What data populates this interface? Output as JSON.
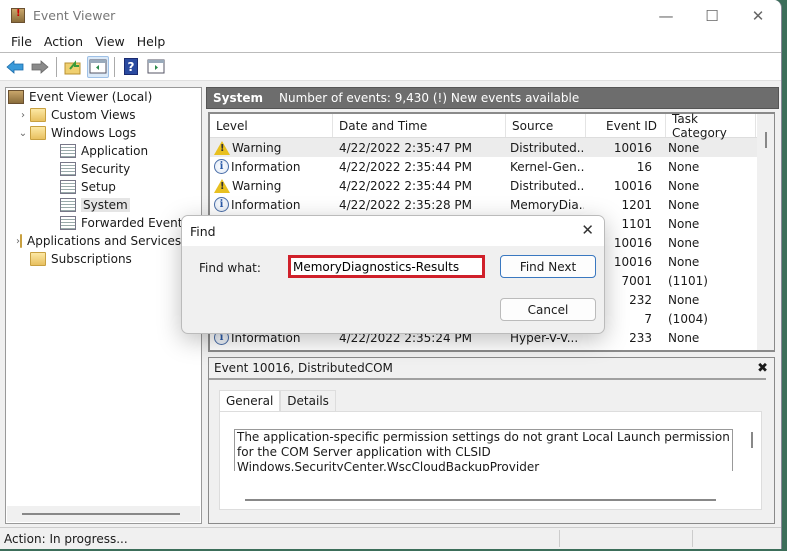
{
  "window": {
    "title": "Event Viewer",
    "minimize": "—",
    "maximize": "☐",
    "close": "✕"
  },
  "menu": [
    "File",
    "Action",
    "View",
    "Help"
  ],
  "toolbar": {
    "icons": [
      "back-arrow-icon",
      "forward-arrow-icon",
      "up-folder-icon",
      "show-hide-console-tree-icon",
      "help-icon",
      "show-hide-action-pane-icon"
    ]
  },
  "tree": [
    {
      "label": "Event Viewer (Local)",
      "indent": 0,
      "chevron": "",
      "icon": "root"
    },
    {
      "label": "Custom Views",
      "indent": 1,
      "chevron": "›",
      "icon": "folder"
    },
    {
      "label": "Windows Logs",
      "indent": 1,
      "chevron": "⌄",
      "icon": "folder"
    },
    {
      "label": "Application",
      "indent": 2,
      "chevron": "",
      "icon": "log"
    },
    {
      "label": "Security",
      "indent": 2,
      "chevron": "",
      "icon": "log"
    },
    {
      "label": "Setup",
      "indent": 2,
      "chevron": "",
      "icon": "log"
    },
    {
      "label": "System",
      "indent": 2,
      "chevron": "",
      "icon": "log",
      "selected": true
    },
    {
      "label": "Forwarded Events",
      "indent": 2,
      "chevron": "",
      "icon": "log"
    },
    {
      "label": "Applications and Services Logs",
      "indent": 1,
      "chevron": "›",
      "icon": "folder"
    },
    {
      "label": "Subscriptions",
      "indent": 1,
      "chevron": "",
      "icon": "folder"
    }
  ],
  "pane": {
    "name": "System",
    "info": "Number of events: 9,430 (!) New events available"
  },
  "grid": {
    "columns": [
      "Level",
      "Date and Time",
      "Source",
      "Event ID",
      "Task Category"
    ],
    "rows": [
      {
        "level": "Warning",
        "date": "4/22/2022 2:35:47 PM",
        "source": "Distributed...",
        "id": "10016",
        "task": "None",
        "selected": true
      },
      {
        "level": "Information",
        "date": "4/22/2022 2:35:44 PM",
        "source": "Kernel-Gen...",
        "id": "16",
        "task": "None"
      },
      {
        "level": "Warning",
        "date": "4/22/2022 2:35:44 PM",
        "source": "Distributed...",
        "id": "10016",
        "task": "None"
      },
      {
        "level": "Information",
        "date": "4/22/2022 2:35:28 PM",
        "source": "MemoryDia...",
        "id": "1201",
        "task": "None"
      },
      {
        "level": "",
        "date": "",
        "source": "",
        "id": "1101",
        "task": "None"
      },
      {
        "level": "",
        "date": "",
        "source": "",
        "id": "10016",
        "task": "None"
      },
      {
        "level": "",
        "date": "",
        "source": "",
        "id": "10016",
        "task": "None"
      },
      {
        "level": "",
        "date": "",
        "source": "",
        "id": "7001",
        "task": "(1101)"
      },
      {
        "level": "",
        "date": "",
        "source": "",
        "id": "232",
        "task": "None"
      },
      {
        "level": "",
        "date": "",
        "source": "",
        "id": "7",
        "task": "(1004)"
      },
      {
        "level": "Information",
        "date": "4/22/2022 2:35:24 PM",
        "source": "Hyper-V-V...",
        "id": "233",
        "task": "None"
      }
    ]
  },
  "detail": {
    "title": "Event 10016, DistributedCOM",
    "close": "✖",
    "tabs": [
      "General",
      "Details"
    ],
    "description": "The application-specific permission settings do not grant Local Launch permission for the COM Server application with CLSID Windows.SecurityCenter.WscCloudBackupProvider"
  },
  "status": {
    "text": "Action:  In progress..."
  },
  "find": {
    "title": "Find",
    "close": "✕",
    "label": "Find what:",
    "value": "MemoryDiagnostics-Results",
    "find_next": "Find Next",
    "cancel": "Cancel"
  }
}
